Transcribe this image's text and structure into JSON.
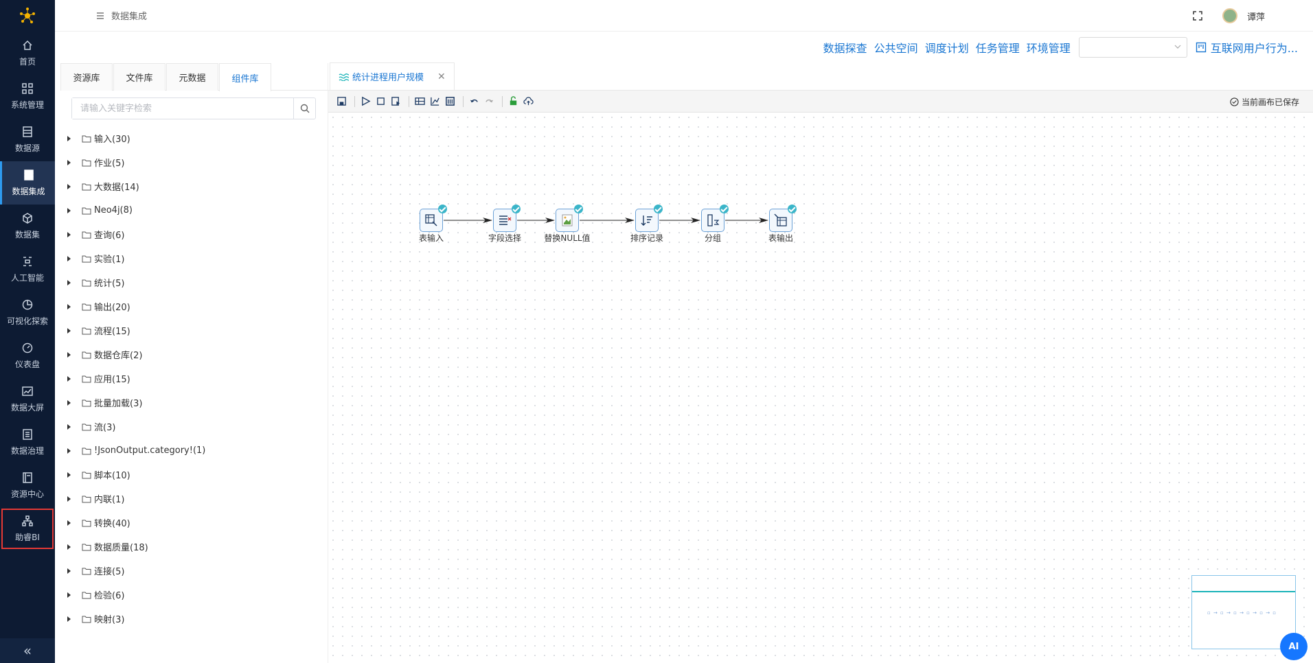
{
  "nav": {
    "items": [
      {
        "label": "首页",
        "icon": "home-icon"
      },
      {
        "label": "系统管理",
        "icon": "grid-icon"
      },
      {
        "label": "数据源",
        "icon": "database-icon"
      },
      {
        "label": "数据集成",
        "icon": "server-icon"
      },
      {
        "label": "数据集",
        "icon": "cube-icon"
      },
      {
        "label": "人工智能",
        "icon": "ai-icon"
      },
      {
        "label": "可视化探索",
        "icon": "pie-icon"
      },
      {
        "label": "仪表盘",
        "icon": "gauge-icon"
      },
      {
        "label": "数据大屏",
        "icon": "chart-icon"
      },
      {
        "label": "数据治理",
        "icon": "doc-icon"
      },
      {
        "label": "资源中心",
        "icon": "book-icon"
      },
      {
        "label": "助睿BI",
        "icon": "org-icon"
      }
    ],
    "active_index": 3,
    "collapse_label": "«"
  },
  "header": {
    "breadcrumb": "数据集成",
    "user_name": "谭萍"
  },
  "submenu": {
    "links": [
      "数据探查",
      "公共空间",
      "调度计划",
      "任务管理",
      "环境管理"
    ],
    "select_value": "",
    "project_label": "互联网用户行为..."
  },
  "library": {
    "tabs": [
      "资源库",
      "文件库",
      "元数据",
      "组件库"
    ],
    "active_tab": 3,
    "search_placeholder": "请输入关键字检索",
    "tree": [
      "输入(30)",
      "作业(5)",
      "大数据(14)",
      "Neo4j(8)",
      "查询(6)",
      "实验(1)",
      "统计(5)",
      "输出(20)",
      "流程(15)",
      "数据仓库(2)",
      "应用(15)",
      "批量加载(3)",
      "流(3)",
      "!JsonOutput.category!(1)",
      "脚本(10)",
      "内联(1)",
      "转换(40)",
      "数据质量(18)",
      "连接(5)",
      "检验(6)",
      "映射(3)"
    ]
  },
  "editor": {
    "tab_title": "统计进程用户规模",
    "saved_status": "当前画布已保存",
    "steps": [
      {
        "label": "表输入",
        "icon": "table-input-icon"
      },
      {
        "label": "字段选择",
        "icon": "field-select-icon"
      },
      {
        "label": "替换NULL值",
        "icon": "broken-image-icon"
      },
      {
        "label": "排序记录",
        "icon": "sort-icon"
      },
      {
        "label": "分组",
        "icon": "group-icon"
      },
      {
        "label": "表输出",
        "icon": "table-output-icon"
      }
    ]
  },
  "ai_button": "AI",
  "colors": {
    "nav_bg": "#0d1b33",
    "accent": "#1976d2",
    "check": "#3bb5c9",
    "highlight": "#e53935"
  }
}
